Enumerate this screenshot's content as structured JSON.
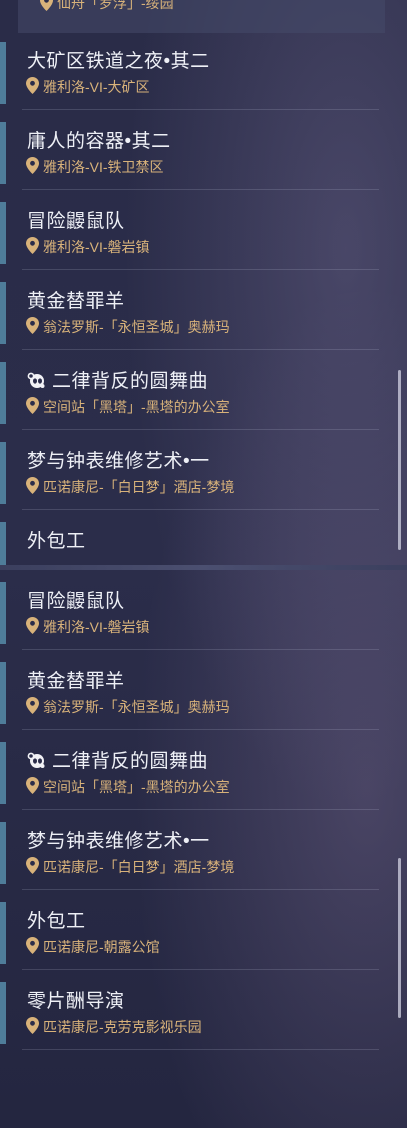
{
  "top_panel": {
    "partial_top": {
      "location": "仙舟「罗浮」-绥园"
    },
    "quests": [
      {
        "title": "大矿区铁道之夜•其二",
        "location": "雅利洛-VI-大矿区"
      },
      {
        "title": "庸人的容器•其二",
        "location": "雅利洛-VI-铁卫禁区"
      },
      {
        "title": "冒险鼹鼠队",
        "location": "雅利洛-VI-磐岩镇"
      },
      {
        "title": "黄金替罪羊",
        "location": "翁法罗斯-「永恒圣城」奥赫玛"
      },
      {
        "title": "二律背反的圆舞曲",
        "location": "空间站「黑塔」-黑塔的办公室",
        "icon": "panda-icon"
      },
      {
        "title": "梦与钟表维修艺术•一",
        "location": "匹诺康尼-「白日梦」酒店-梦境"
      },
      {
        "title": "外包工",
        "location": ""
      }
    ]
  },
  "bottom_panel": {
    "quests": [
      {
        "title": "冒险鼹鼠队",
        "location": "雅利洛-VI-磐岩镇"
      },
      {
        "title": "黄金替罪羊",
        "location": "翁法罗斯-「永恒圣城」奥赫玛"
      },
      {
        "title": "二律背反的圆舞曲",
        "location": "空间站「黑塔」-黑塔的办公室",
        "icon": "panda-icon"
      },
      {
        "title": "梦与钟表维修艺术•一",
        "location": "匹诺康尼-「白日梦」酒店-梦境"
      },
      {
        "title": "外包工",
        "location": "匹诺康尼-朝露公馆"
      },
      {
        "title": "零片酬导演",
        "location": "匹诺康尼-克劳克影视乐园"
      }
    ]
  },
  "colors": {
    "accent": "#4f7d9a",
    "location_text": "#d8b27a",
    "title_text": "#eef0f6"
  }
}
